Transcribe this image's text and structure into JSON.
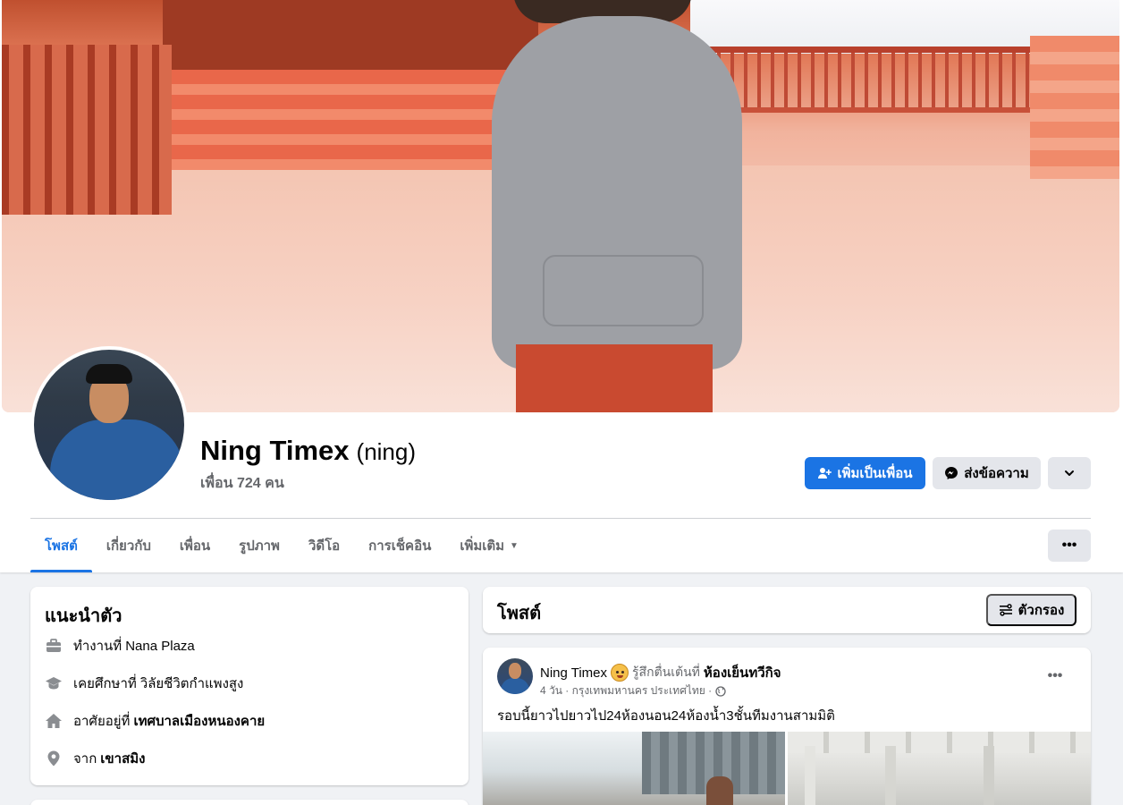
{
  "profile": {
    "name": "Ning Timex",
    "alt_name": "(ning)",
    "friends": "เพื่อน 724 คน"
  },
  "actions": {
    "add_friend": "เพิ่มเป็นเพื่อน",
    "message": "ส่งข้อความ"
  },
  "tabs": [
    {
      "label": "โพสต์",
      "active": true
    },
    {
      "label": "เกี่ยวกับ"
    },
    {
      "label": "เพื่อน"
    },
    {
      "label": "รูปภาพ"
    },
    {
      "label": "วิดีโอ"
    },
    {
      "label": "การเช็คอิน"
    },
    {
      "label": "เพิ่มเติม"
    }
  ],
  "intro": {
    "title": "แนะนำตัว",
    "work": {
      "prefix": "ทำงานที่",
      "value": "Nana Plaza"
    },
    "education": {
      "prefix": "เคยศึกษาที่",
      "value": "วิลัยชีวิตกำแพงสูง"
    },
    "lives": {
      "prefix": "อาศัยอยู่ที่",
      "value": "เทศบาลเมืองหนองคาย"
    },
    "from": {
      "prefix": "จาก",
      "value": "เขาสมิง"
    }
  },
  "posts_header": {
    "title": "โพสต์",
    "filter": "ตัวกรอง"
  },
  "post": {
    "author": "Ning Timex",
    "feeling": "รู้สึกตื่นเต้นที่",
    "place": "ห้องเย็นทวีกิจ",
    "meta": "4 วัน · กรุงเทพมหานคร ประเทศไทย ·",
    "text": "รอบนี้ยาวไปยาวไป24ห้องนอน24ห้องน้ำ3ชั้นทีมงานสามมิติ"
  },
  "colors": {
    "primary": "#1b74e4",
    "secondary_button": "#e4e6eb",
    "page_background": "#f0f2f5",
    "muted_text": "#65676b"
  },
  "icons": {
    "add_friend": "add-person-icon",
    "message": "messenger-icon",
    "work": "briefcase-icon",
    "education": "graduation-cap-icon",
    "lives": "home-icon",
    "from": "location-pin-icon",
    "filter": "filter-icon",
    "privacy": "globe-icon"
  }
}
